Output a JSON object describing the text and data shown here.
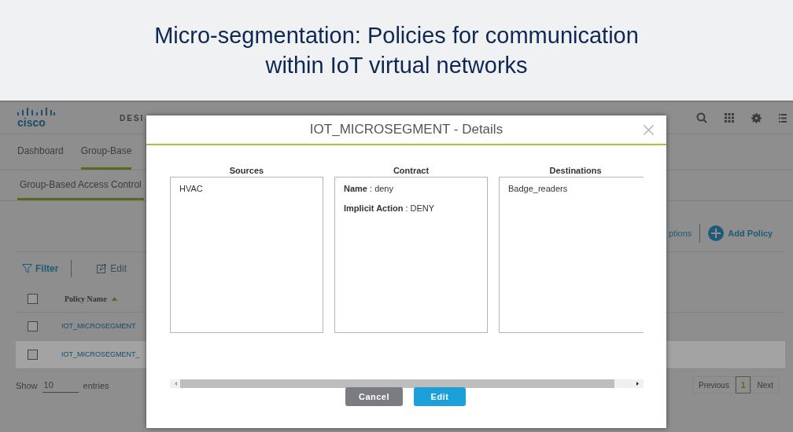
{
  "slide_title": {
    "lines": [
      "Micro-segmentation: Policies for communication",
      "within IoT virtual networks"
    ]
  },
  "app": {
    "logo_text": "cisco",
    "nav_label": "DESI",
    "tabs": [
      {
        "label": "Dashboard",
        "selected": false
      },
      {
        "label": "Group-Base",
        "selected": true
      }
    ],
    "subtabs": [
      {
        "label": "Group-Based Access Control",
        "selected": true
      }
    ],
    "toolbar": {
      "filter": "Filter",
      "edit": "Edit",
      "options": "ptions",
      "add": "Add Policy"
    },
    "table": {
      "header_checked": false,
      "columns": [
        "Policy Name"
      ],
      "rows": [
        {
          "name": "IOT_MICROSEGMENT",
          "checked": false,
          "selected": false
        },
        {
          "name": "IOT_MICROSEGMENT_",
          "checked": false,
          "selected": true
        }
      ]
    },
    "length": {
      "label": "Show",
      "value": "10",
      "suffix": "entries"
    },
    "pagination": {
      "previous": "Previous",
      "pages": [
        {
          "label": "1",
          "selected": true
        }
      ],
      "next": "Next"
    }
  },
  "dialog": {
    "title": "IOT_MICROSEGMENT - Details",
    "columns": [
      {
        "heading": "Sources",
        "items": [
          "HVAC"
        ]
      },
      {
        "heading": "Contract",
        "items": [
          "**Name** : deny",
          "**Implicit Action** : DENY"
        ]
      },
      {
        "heading": "Destinations",
        "items": [
          "Badge_readers"
        ]
      }
    ],
    "buttons": [
      {
        "label": "Cancel",
        "kind": "secondary"
      },
      {
        "label": "Edit",
        "kind": "primary"
      }
    ]
  }
}
